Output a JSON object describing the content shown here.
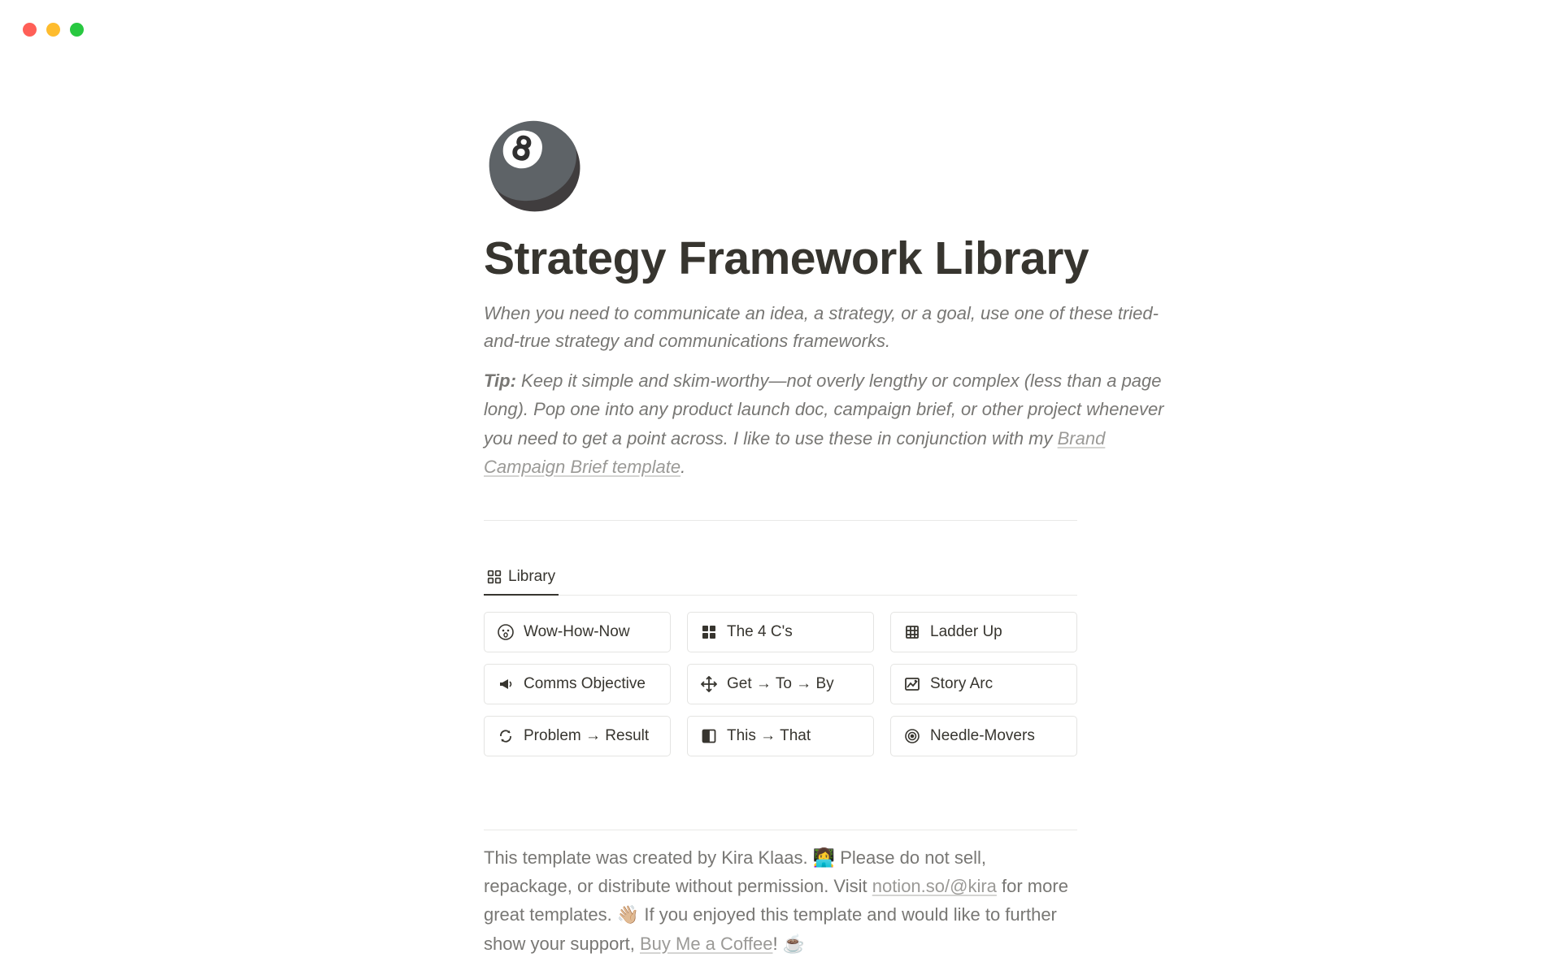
{
  "page": {
    "icon": "🎱",
    "title": "Strategy Framework Library",
    "description": "When you need to communicate an idea, a strategy, or a goal, use one of these tried-and-true strategy and communications frameworks.",
    "tip_label": "Tip:",
    "tip_body_1": " Keep it simple and skim-worthy—not overly lengthy or complex (less than a page long). Pop one into any product launch doc, campaign brief, or other project whenever you need to get a point across. I like to use these in conjunction with my ",
    "tip_link": "Brand Campaign Brief template",
    "tip_body_2": "."
  },
  "tabs": {
    "active": "Library"
  },
  "cards": [
    {
      "icon": "astonished",
      "label": "Wow-How-Now"
    },
    {
      "icon": "puzzle",
      "label": "The 4 C's"
    },
    {
      "icon": "ladder",
      "label": "Ladder Up"
    },
    {
      "icon": "megaphone",
      "label": "Comms Objective"
    },
    {
      "icon": "arrows",
      "label": "Get → To → By"
    },
    {
      "icon": "frame",
      "label": "Story Arc"
    },
    {
      "icon": "cycle",
      "label": "Problem → Result"
    },
    {
      "icon": "split",
      "label": "This → That"
    },
    {
      "icon": "target",
      "label": "Needle-Movers"
    }
  ],
  "footer": {
    "t1": "This template was created by Kira Klaas. 👩‍💻 Please do not sell, repackage, or distribute without permission. Visit ",
    "link1": "notion.so/@kira",
    "t2": " for more great templates. 👋🏼 If you enjoyed this template and would like to further show your support, ",
    "link2": "Buy Me a Coffee",
    "t3": "! ☕"
  }
}
